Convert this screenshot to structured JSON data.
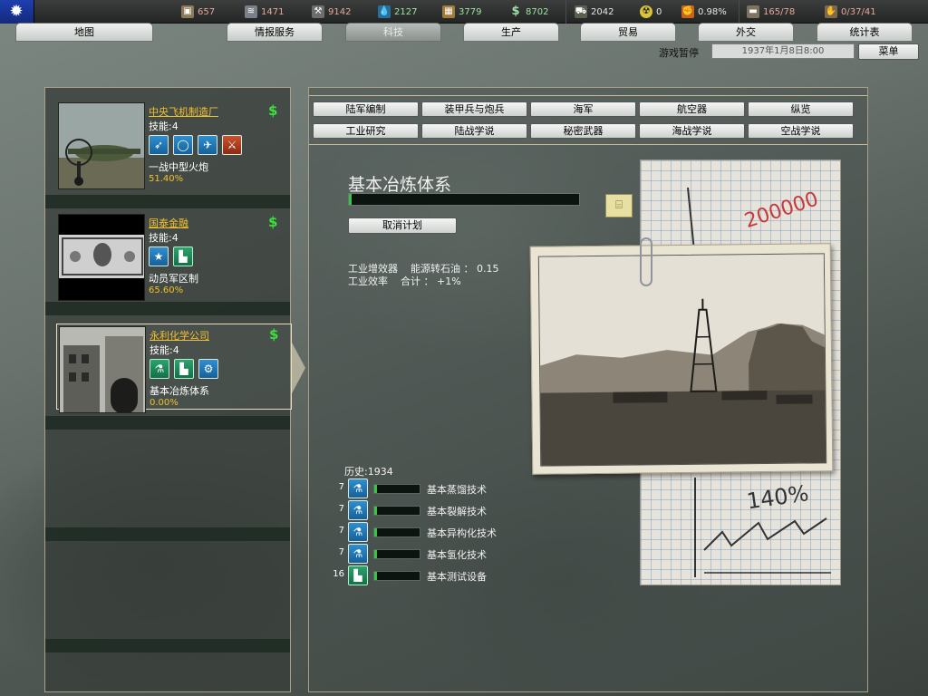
{
  "topbar": {
    "resources": [
      {
        "icon": "supplies-icon",
        "value": "657",
        "color": "#e8a79c"
      },
      {
        "icon": "manpower-icon",
        "value": "1471",
        "color": "#e8a79c"
      },
      {
        "icon": "metal-icon",
        "value": "9142",
        "color": "#e8a79c"
      },
      {
        "icon": "oil-icon",
        "value": "2127",
        "color": "#9fe0a6"
      },
      {
        "icon": "rare-materials-icon",
        "value": "3779",
        "color": "#9fe0a6"
      },
      {
        "icon": "money-icon",
        "value": "8702",
        "color": "#9fe0a6"
      },
      {
        "icon": "transports-icon",
        "value": "2042",
        "color": "#e6e6e6"
      },
      {
        "icon": "nuclear-icon",
        "value": "0",
        "color": "#e6e6e6"
      },
      {
        "icon": "dissent-icon",
        "value": "0.98%",
        "color": "#e6e6e6"
      },
      {
        "icon": "convoys-icon",
        "value": "165/78",
        "color": "#e8a79c"
      },
      {
        "icon": "divisions-icon",
        "value": "0/37/41",
        "color": "#e8a79c"
      }
    ]
  },
  "nav": {
    "tabs": [
      {
        "label": "地图"
      },
      {
        "label": "情报服务"
      },
      {
        "label": "科技"
      },
      {
        "label": "生产"
      },
      {
        "label": "贸易"
      },
      {
        "label": "外交"
      },
      {
        "label": "统计表"
      }
    ],
    "active": "科技"
  },
  "status": {
    "paused": "游戏暂停",
    "date": "1937年1月8日8:00",
    "menu": "菜单"
  },
  "teams": [
    {
      "name": "中央飞机制造厂",
      "skill": "技能:4",
      "project": "一战中型火炮",
      "progress": "51.40%",
      "icons": [
        "aircraft-engine-icon",
        "lightbulb-icon",
        "propeller-icon",
        "artillery-icon"
      ]
    },
    {
      "name": "国泰金融",
      "skill": "技能:4",
      "project": "动员军区制",
      "progress": "65.60%",
      "icons": [
        "star-icon",
        "factory-icon"
      ]
    },
    {
      "name": "永利化学公司",
      "skill": "技能:4",
      "project": "基本冶炼体系",
      "progress": "0.00%",
      "icons": [
        "flask-icon",
        "factory-icon",
        "gears-icon"
      ]
    }
  ],
  "categories": {
    "row1": [
      "陆军编制",
      "装甲兵与炮兵",
      "海军",
      "航空器",
      "纵览"
    ],
    "row2": [
      "工业研究",
      "陆战学说",
      "秘密武器",
      "海战学说",
      "空战学说"
    ]
  },
  "tech": {
    "title": "基本冶炼体系",
    "progress": 0.01,
    "cancel": "取消计划",
    "effects": [
      "工业增效器    能源转石油 ： 0.15",
      "工业效率    合计 ： +1%"
    ]
  },
  "history": {
    "label": "历史:1934",
    "items": [
      {
        "num": "7",
        "label": "基本蒸馏技术",
        "icon": "flask-icon",
        "fill": 0.06
      },
      {
        "num": "7",
        "label": "基本裂解技术",
        "icon": "flask-icon",
        "fill": 0.06
      },
      {
        "num": "7",
        "label": "基本异构化技术",
        "icon": "flask-icon",
        "fill": 0.06
      },
      {
        "num": "7",
        "label": "基本氢化技术",
        "icon": "flask-icon",
        "fill": 0.06
      },
      {
        "num": "16",
        "label": "基本测试设备",
        "icon": "factory-icon",
        "fill": 0.06
      }
    ]
  },
  "art": {
    "notebook_scribbles": [
      "200000",
      "140%"
    ]
  }
}
